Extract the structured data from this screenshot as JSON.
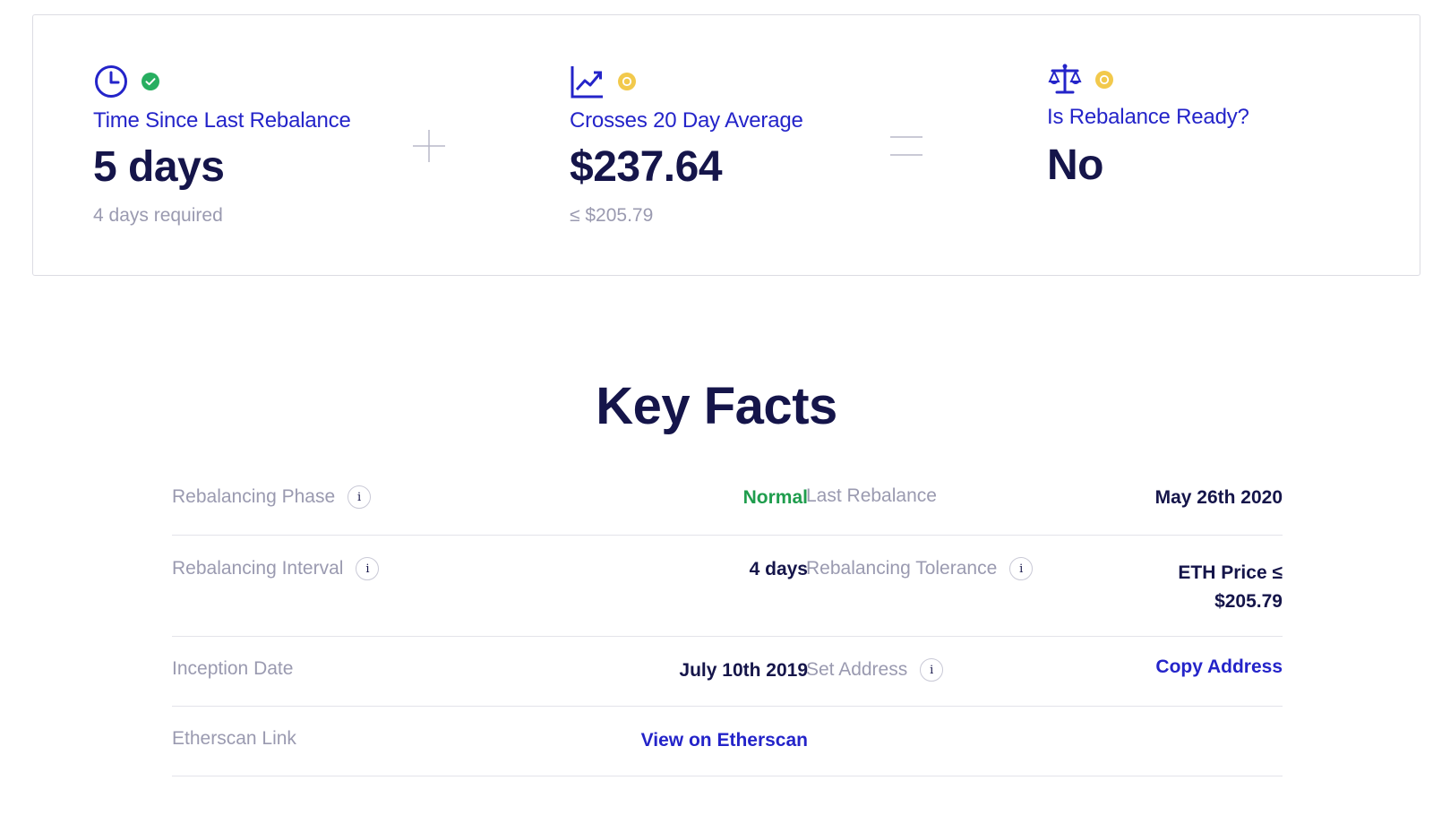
{
  "status": {
    "time_since": {
      "icon": "clock-icon",
      "status": "complete",
      "status_color": "#27ae60",
      "label": "Time Since Last Rebalance",
      "value": "5 days",
      "sub": "4 days required"
    },
    "crosses_average": {
      "icon": "line-chart-icon",
      "status": "pending",
      "status_color": "#f2c94c",
      "label": "Crosses 20 Day Average",
      "value": "$237.64",
      "sub": "≤ $205.79"
    },
    "rebalance_ready": {
      "icon": "scales-icon",
      "status": "pending",
      "status_color": "#f2c94c",
      "label": "Is Rebalance Ready?",
      "value": "No"
    }
  },
  "key_facts": {
    "title": "Key Facts",
    "rows": [
      [
        {
          "label": "Rebalancing Phase",
          "info": true,
          "value": "Normal",
          "value_color": "#1f9d4d"
        },
        {
          "label": "Last Rebalance",
          "info": false,
          "value": "May 26th 2020"
        }
      ],
      [
        {
          "label": "Rebalancing Interval",
          "info": true,
          "value": "4 days"
        },
        {
          "label": "Rebalancing Tolerance",
          "info": true,
          "value_line1": "ETH Price ≤",
          "value_line2": "$205.79"
        }
      ],
      [
        {
          "label": "Inception Date",
          "info": false,
          "value": "July 10th 2019"
        },
        {
          "label": "Set Address",
          "info": true,
          "link": "Copy Address"
        }
      ],
      [
        {
          "label": "Etherscan Link",
          "info": false,
          "link": "View on Etherscan"
        }
      ]
    ]
  },
  "colors": {
    "accent": "#2424c9",
    "heading": "#15154a",
    "muted": "#9a9ab0",
    "success": "#1f9d4d",
    "warning": "#f2c94c"
  }
}
